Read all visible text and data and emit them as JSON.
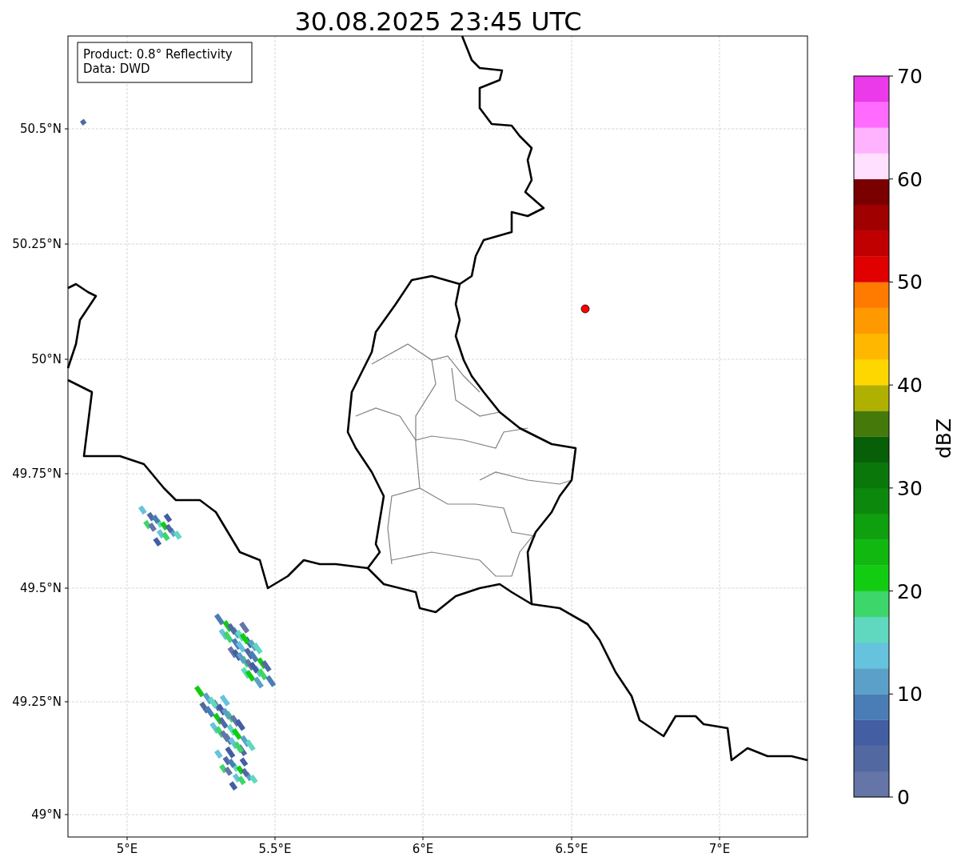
{
  "title": "30.08.2025 23:45 UTC",
  "info_box": {
    "lines": [
      "Product: 0.8° Reflectivity",
      "Data: DWD"
    ]
  },
  "map": {
    "lat_ticks": [
      "50.5°N",
      "50.25°N",
      "50°N",
      "49.75°N",
      "49.5°N",
      "49.25°N",
      "49°N"
    ],
    "lon_ticks": [
      "5°E",
      "5.5°E",
      "6°E",
      "6.5°E",
      "7°E"
    ]
  },
  "colorbar": {
    "label": "dBZ",
    "ticks": [
      "70",
      "60",
      "50",
      "40",
      "30",
      "20",
      "10",
      "0"
    ],
    "bins": [
      {
        "color": "#6575a8"
      },
      {
        "color": "#5168a0"
      },
      {
        "color": "#435ea3"
      },
      {
        "color": "#4a7db5"
      },
      {
        "color": "#5ba0c8"
      },
      {
        "color": "#66c3dd"
      },
      {
        "color": "#60d8c0"
      },
      {
        "color": "#3dd66a"
      },
      {
        "color": "#12cc12"
      },
      {
        "color": "#10b810"
      },
      {
        "color": "#0ea00e"
      },
      {
        "color": "#0c880c"
      },
      {
        "color": "#0a770a"
      },
      {
        "color": "#075f07"
      },
      {
        "color": "#457a0a"
      },
      {
        "color": "#b0b000"
      },
      {
        "color": "#ffd700"
      },
      {
        "color": "#ffb700"
      },
      {
        "color": "#ff9900"
      },
      {
        "color": "#ff7b00"
      },
      {
        "color": "#e00000"
      },
      {
        "color": "#c00000"
      },
      {
        "color": "#a00000"
      },
      {
        "color": "#7a0000"
      },
      {
        "color": "#ffe0ff"
      },
      {
        "color": "#ffb3ff"
      },
      {
        "color": "#ff6bff"
      },
      {
        "color": "#ea3aea"
      }
    ]
  }
}
